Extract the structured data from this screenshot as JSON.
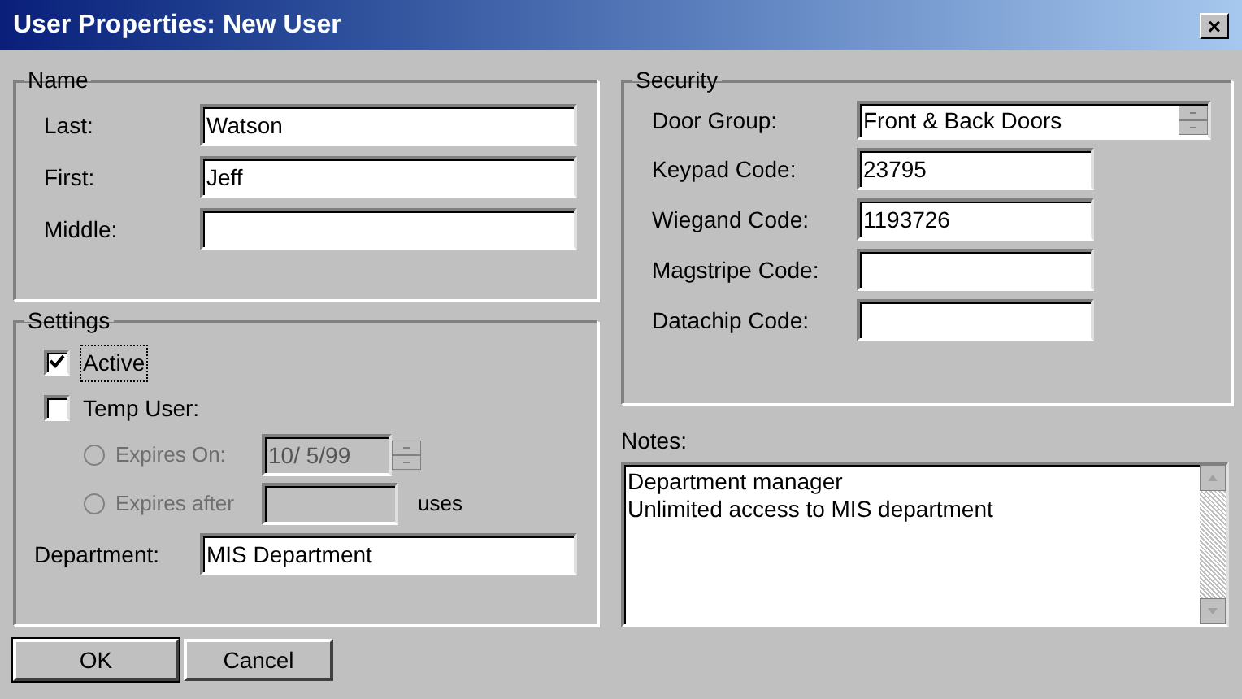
{
  "window": {
    "title": "User Properties: New User",
    "close": "×"
  },
  "name_group": {
    "label": "Name",
    "fields": [
      {
        "label": "Last:",
        "value": "Watson"
      },
      {
        "label": "First:",
        "value": "Jeff"
      },
      {
        "label": "Middle:"
      }
    ]
  },
  "settings": {
    "label": "Settings",
    "active": {
      "label": "Active",
      "checked": true
    },
    "temp_user": {
      "label": "Temp User:",
      "checked": false
    },
    "expires_on": {
      "label": "Expires On:",
      "selected": false,
      "disabled": true,
      "value": "10/ 5/99"
    },
    "expires_after": {
      "label": "Expires after",
      "selected": false,
      "disabled": true,
      "suffix": "uses"
    },
    "department": {
      "label": "Department:",
      "value": "MIS Department"
    }
  },
  "security": {
    "label": "Security",
    "door_group": {
      "label": "Door Group:",
      "value": "Front & Back Doors"
    },
    "fields": [
      {
        "label": "Keypad Code:",
        "value": "23795"
      },
      {
        "label": "Wiegand Code:",
        "value": "1193726"
      },
      {
        "label": "Magstripe Code:"
      },
      {
        "label": "Datachip Code:"
      }
    ]
  },
  "notes": {
    "label": "Notes:",
    "value": "Department manager\nUnlimited access to MIS department"
  },
  "buttons": [
    {
      "label": "OK",
      "default": true
    },
    {
      "label": "Cancel",
      "default": false
    }
  ]
}
